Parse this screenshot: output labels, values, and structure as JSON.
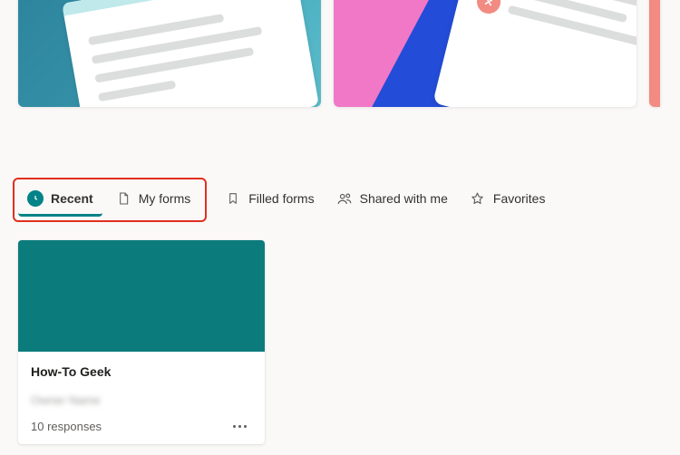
{
  "tabs": {
    "recent": {
      "label": "Recent"
    },
    "myForms": {
      "label": "My forms"
    },
    "filled": {
      "label": "Filled forms"
    },
    "shared": {
      "label": "Shared with me"
    },
    "favorites": {
      "label": "Favorites"
    }
  },
  "forms": [
    {
      "title": "How-To Geek",
      "owner": "Owner Name",
      "responses": "10 responses",
      "coverColor": "#0b7b7c"
    }
  ],
  "colors": {
    "accent": "#038387",
    "highlight": "#e0301e"
  }
}
